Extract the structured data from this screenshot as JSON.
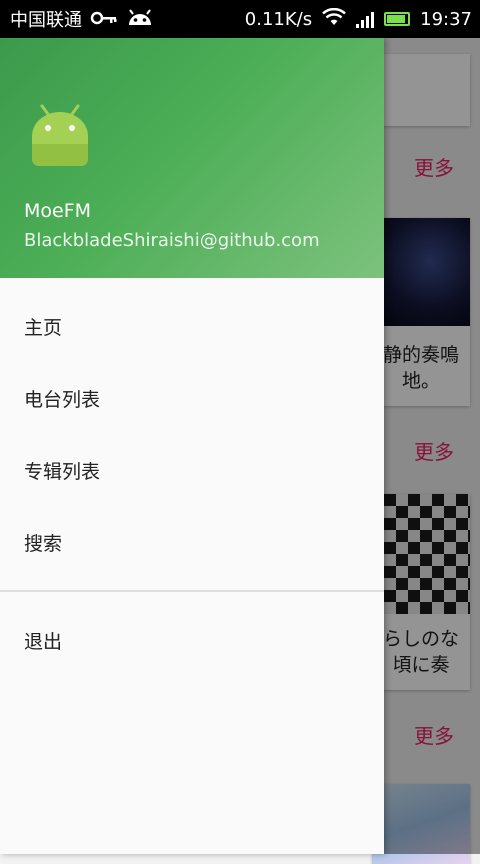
{
  "status_bar": {
    "carrier": "中国联通",
    "speed": "0.11K/s",
    "time": "19:37",
    "battery_level": 0.9,
    "colors": {
      "battery": "#7be04b"
    }
  },
  "background": {
    "more_labels": [
      "更多",
      "更多",
      "更多"
    ],
    "card_texts": [
      "静的奏鳴",
      "地。",
      "らしのな",
      "頃に奏"
    ]
  },
  "drawer": {
    "app_name": "MoeFM",
    "email": "BlackbladeShiraishi@github.com",
    "menu": [
      {
        "label": "主页"
      },
      {
        "label": "电台列表"
      },
      {
        "label": "专辑列表"
      },
      {
        "label": "搜索"
      }
    ],
    "logout_label": "退出",
    "colors": {
      "header_start": "#3b9a4c",
      "header_end": "#7dc27e",
      "accent": "#e91e63"
    }
  }
}
